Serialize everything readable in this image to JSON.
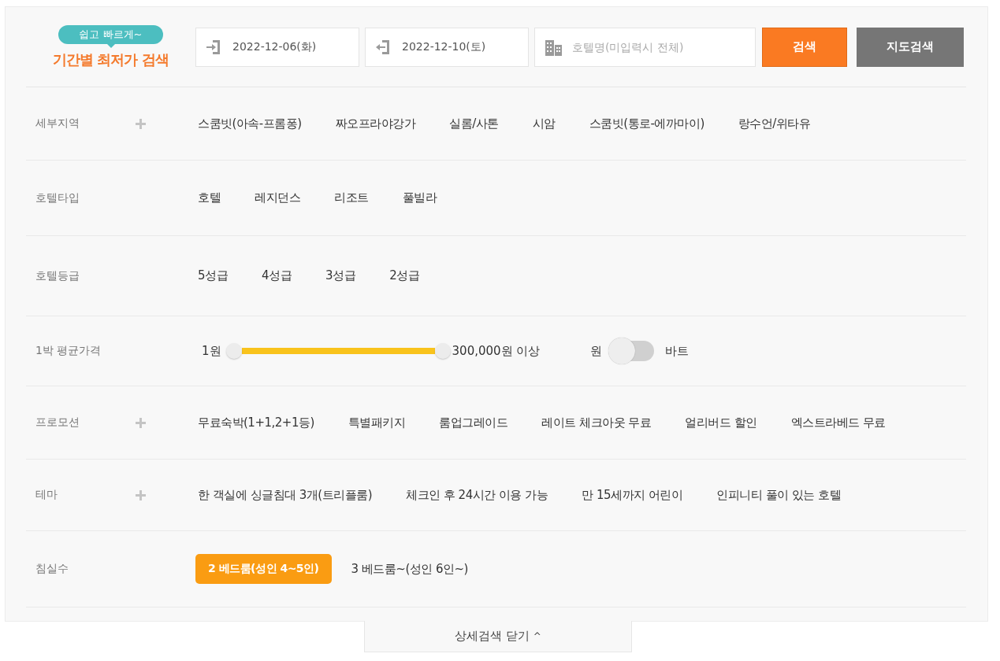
{
  "header": {
    "bubble": "쉽고 빠르게~",
    "title": "기간별 최저가 검색",
    "checkin": "2022-12-06(화)",
    "checkout": "2022-12-10(토)",
    "hotel_search": {
      "placeholder": "호텔명(미입력시 전체)"
    },
    "buttons": [
      {
        "label": "검색",
        "kind": "primary"
      },
      {
        "label": "지도검색",
        "kind": "secondary"
      }
    ]
  },
  "filters": [
    {
      "kind": "options",
      "label": "세부지역",
      "expandable": true,
      "options": [
        {
          "label": "스쿰빗(아속-프롬퐁)",
          "selected": false
        },
        {
          "label": "짜오프라야강가",
          "selected": false
        },
        {
          "label": "실롬/사톤",
          "selected": false
        },
        {
          "label": "시암",
          "selected": false
        },
        {
          "label": "스쿰빗(통로-에까마이)",
          "selected": false
        },
        {
          "label": "랑수언/위타유",
          "selected": false
        }
      ]
    },
    {
      "kind": "options",
      "label": "호텔타입",
      "expandable": false,
      "options": [
        {
          "label": "호텔",
          "selected": false
        },
        {
          "label": "레지던스",
          "selected": false
        },
        {
          "label": "리조트",
          "selected": false
        },
        {
          "label": "풀빌라",
          "selected": false
        }
      ]
    },
    {
      "kind": "options",
      "label": "호텔등급",
      "expandable": false,
      "options": [
        {
          "label": "5성급",
          "selected": false
        },
        {
          "label": "4성급",
          "selected": false
        },
        {
          "label": "3성급",
          "selected": false
        },
        {
          "label": "2성급",
          "selected": false
        }
      ]
    },
    {
      "kind": "slider",
      "label": "1박 평균가격",
      "min_label": "1원",
      "max_label": "300,000원 이상",
      "level": 1,
      "currency": {
        "left": "원",
        "right": "바트",
        "on": false
      }
    },
    {
      "kind": "options",
      "label": "프로모션",
      "expandable": true,
      "options": [
        {
          "label": "무료숙박(1+1,2+1등)",
          "selected": false
        },
        {
          "label": "특별패키지",
          "selected": false
        },
        {
          "label": "룸업그레이드",
          "selected": false
        },
        {
          "label": "레이트 체크아웃 무료",
          "selected": false
        },
        {
          "label": "얼리버드 할인",
          "selected": false
        },
        {
          "label": "엑스트라베드 무료",
          "selected": false
        }
      ]
    },
    {
      "kind": "options",
      "label": "테마",
      "expandable": true,
      "options": [
        {
          "label": "한 객실에 싱글침대 3개(트리플룸)",
          "selected": false
        },
        {
          "label": "체크인 후 24시간 이용 가능",
          "selected": false
        },
        {
          "label": "만 15세까지 어린이",
          "selected": false
        },
        {
          "label": "인피니티 풀이 있는 호텔",
          "selected": false
        }
      ]
    },
    {
      "kind": "options",
      "label": "침실수",
      "expandable": false,
      "options": [
        {
          "label": "2 베드룸(성인 4~5인)",
          "selected": true
        },
        {
          "label": "3 베드룸~(성인 6인~)",
          "selected": false
        }
      ]
    }
  ],
  "close_tab": {
    "label": "상세검색 닫기",
    "caret": "^"
  }
}
